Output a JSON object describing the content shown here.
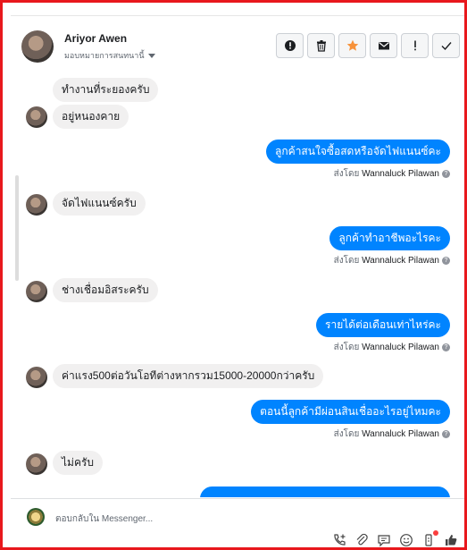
{
  "header": {
    "name": "Ariyor Awen",
    "assign_label": "มอบหมายการสนทนานี้",
    "tools": [
      "flag-icon",
      "trash-icon",
      "star-icon",
      "envelope-icon",
      "exclamation-icon",
      "check-icon"
    ]
  },
  "messages": [
    {
      "dir": "in",
      "text": "ทำงานที่ระยองครับ"
    },
    {
      "dir": "in",
      "text": "อยู่หนองคาย"
    },
    {
      "dir": "out",
      "text": "ลูกค้าสนใจซื้อสดหรือจัดไฟแนนซ์คะ",
      "sent_by": "ส่งโดย",
      "agent": "Wannaluck Pilawan"
    },
    {
      "dir": "in",
      "text": "จัดไฟแนนซ์ครับ"
    },
    {
      "dir": "out",
      "text": "ลูกค้าทำอาชีพอะไรคะ",
      "sent_by": "ส่งโดย",
      "agent": "Wannaluck Pilawan"
    },
    {
      "dir": "in",
      "text": "ช่างเชื่อมอิสระครับ"
    },
    {
      "dir": "out",
      "text": "รายได้ต่อเดือนเท่าไหร่คะ",
      "sent_by": "ส่งโดย",
      "agent": "Wannaluck Pilawan"
    },
    {
      "dir": "in",
      "text": "ค่าแรง500ต่อวันโอทีต่างหากรวม15000-20000กว่าครับ"
    },
    {
      "dir": "out",
      "text": "ตอนนี้ลูกค้ามีผ่อนสินเชื่ออะไรอยู่ไหมคะ",
      "sent_by": "ส่งโดย",
      "agent": "Wannaluck Pilawan"
    },
    {
      "dir": "in",
      "text": "ไม่ครับ"
    }
  ],
  "composer": {
    "placeholder": "ตอบกลับใน Messenger...",
    "icons": [
      "phone-plus-icon",
      "attachment-icon",
      "saved-reply-icon",
      "emoji-icon",
      "bot-icon",
      "like-icon"
    ]
  },
  "colors": {
    "accent": "#0084ff",
    "frame": "#e8181d",
    "star": "#f7923a"
  }
}
